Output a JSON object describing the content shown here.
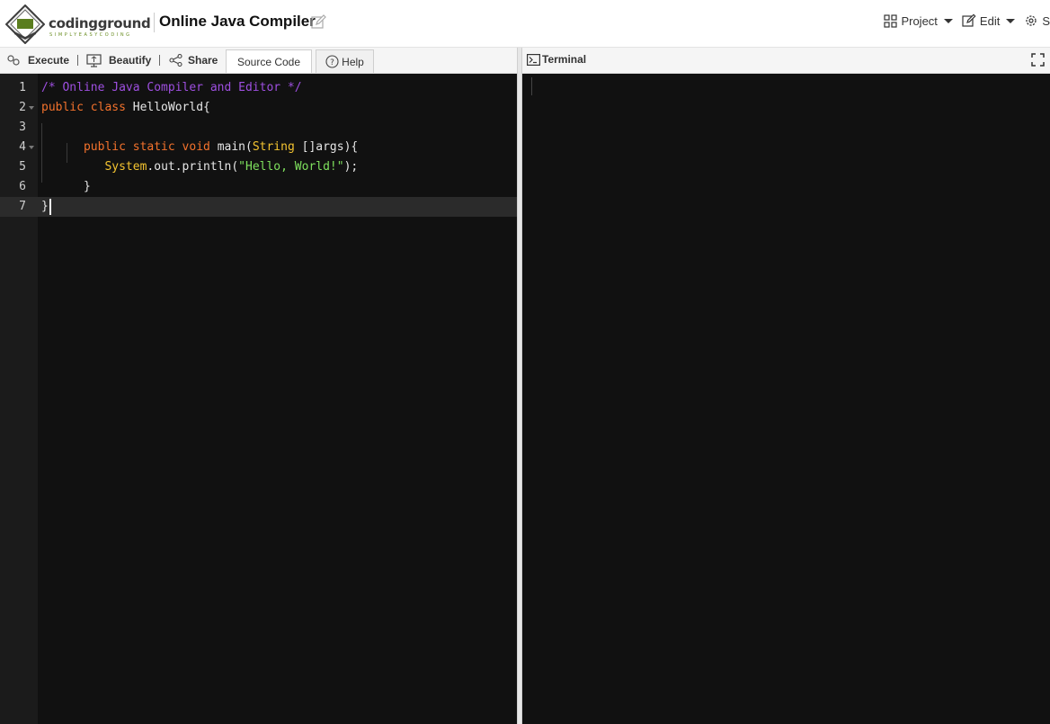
{
  "header": {
    "logo_text": "codingground",
    "logo_sub": "SIMPLYEASYCODING",
    "title": "Online Java Compiler",
    "menu": {
      "project": "Project",
      "edit": "Edit",
      "settings_partial": "S"
    }
  },
  "toolbar": {
    "execute": "Execute",
    "beautify": "Beautify",
    "share": "Share",
    "tab_source": "Source Code",
    "tab_help": "Help"
  },
  "editor": {
    "line_numbers": [
      "1",
      "2",
      "3",
      "4",
      "5",
      "6",
      "7"
    ],
    "lines": [
      [
        {
          "t": "/* Online Java Compiler and Editor */",
          "c": "comment"
        }
      ],
      [
        {
          "t": "public class ",
          "c": "kw"
        },
        {
          "t": "HelloWorld{",
          "c": "plain"
        }
      ],
      [],
      [
        {
          "t": "      "
        },
        {
          "t": "public static void ",
          "c": "kw"
        },
        {
          "t": "main(",
          "c": "plain"
        },
        {
          "t": "String",
          "c": "type"
        },
        {
          "t": " []args){",
          "c": "plain"
        }
      ],
      [
        {
          "t": "         "
        },
        {
          "t": "System",
          "c": "type"
        },
        {
          "t": ".out.println(",
          "c": "plain"
        },
        {
          "t": "\"Hello, World!\"",
          "c": "str"
        },
        {
          "t": ");",
          "c": "plain"
        }
      ],
      [
        {
          "t": "      }",
          "c": "plain"
        }
      ],
      [
        {
          "t": "}",
          "c": "plain"
        }
      ]
    ]
  },
  "terminal": {
    "label": "Terminal"
  },
  "colors": {
    "editor_bg": "#111111",
    "comment": "#9e4fe0",
    "keyword": "#f3722c",
    "type": "#f4c430",
    "string": "#7ee05d"
  }
}
